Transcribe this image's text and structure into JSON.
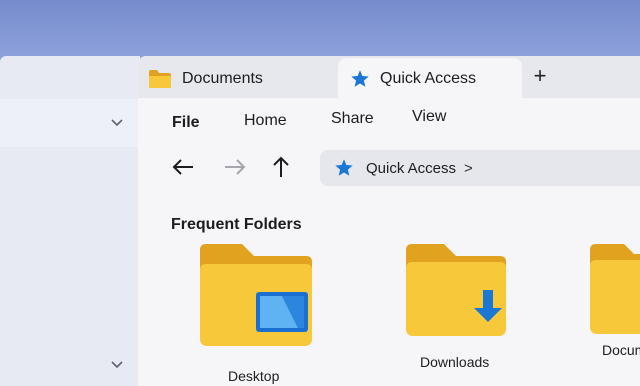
{
  "window": {
    "tabs": [
      {
        "label": "Documents",
        "icon": "folder-icon",
        "active": false
      },
      {
        "label": "Quick Access",
        "icon": "star-icon",
        "active": true
      }
    ],
    "new_tab_label": "+"
  },
  "menu": {
    "file": "File",
    "home": "Home",
    "share": "Share",
    "view": "View"
  },
  "nav": {
    "back_icon": "arrow-left-icon",
    "forward_icon": "arrow-right-icon",
    "up_icon": "arrow-up-icon"
  },
  "address": {
    "crumb": "Quick Access",
    "separator": ">"
  },
  "main": {
    "section_title": "Frequent Folders",
    "folders": [
      {
        "label": "Desktop",
        "icon": "desktop-folder-icon"
      },
      {
        "label": "Downloads",
        "icon": "downloads-folder-icon"
      },
      {
        "label": "Docum",
        "icon": "documents-folder-icon"
      }
    ]
  },
  "colors": {
    "accent": "#1a78d4",
    "folder_yellow": "#f3c02f",
    "folder_tab": "#e0a21f"
  }
}
